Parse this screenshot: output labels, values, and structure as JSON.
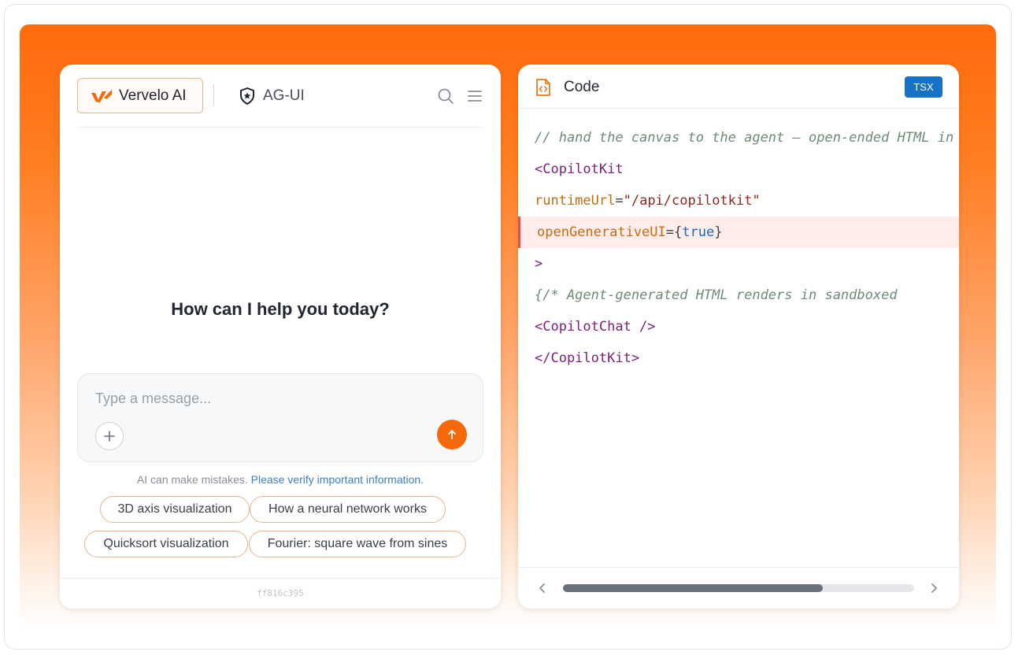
{
  "chat": {
    "brand_name": "Vervelo AI",
    "tab_label": "AG-UI",
    "welcome": "How can I help you today?",
    "composer_placeholder": "Type a message...",
    "disclaimer_text": "AI can make mistakes.",
    "disclaimer_link": "Please verify important information.",
    "suggestions": [
      "3D axis visualization",
      "How a neural network works",
      "Quicksort visualization",
      "Fourier: square wave from sines"
    ],
    "build_hash": "ff816c395"
  },
  "code": {
    "title": "Code",
    "language_badge": "TSX",
    "highlighted_line": 4,
    "scroll_position": 0.74,
    "lines": [
      [
        {
          "t": "// hand the canvas to the agent – open-ended HTML in",
          "k": "comment"
        }
      ],
      [
        {
          "t": "<CopilotKit",
          "k": "tag"
        }
      ],
      [
        {
          "t": "runtimeUrl",
          "k": "attr"
        },
        {
          "t": "=",
          "k": "punct"
        },
        {
          "t": "\"/api/copilotkit\"",
          "k": "string"
        }
      ],
      [
        {
          "t": "openGenerativeUI",
          "k": "attr"
        },
        {
          "t": "={",
          "k": "punct"
        },
        {
          "t": "true",
          "k": "bool"
        },
        {
          "t": "}",
          "k": "punct"
        }
      ],
      [
        {
          "t": ">",
          "k": "tag"
        }
      ],
      [
        {
          "t": "{/* Agent-generated HTML renders in sandboxed",
          "k": "comment"
        }
      ],
      [
        {
          "t": "<CopilotChat />",
          "k": "tag"
        }
      ],
      [
        {
          "t": "</CopilotKit>",
          "k": "tag"
        }
      ]
    ]
  },
  "colors": {
    "accent": "#f46a0a",
    "badge": "#1672c7",
    "highlight_bg": "#fdecea",
    "highlight_border": "#e0524d"
  }
}
